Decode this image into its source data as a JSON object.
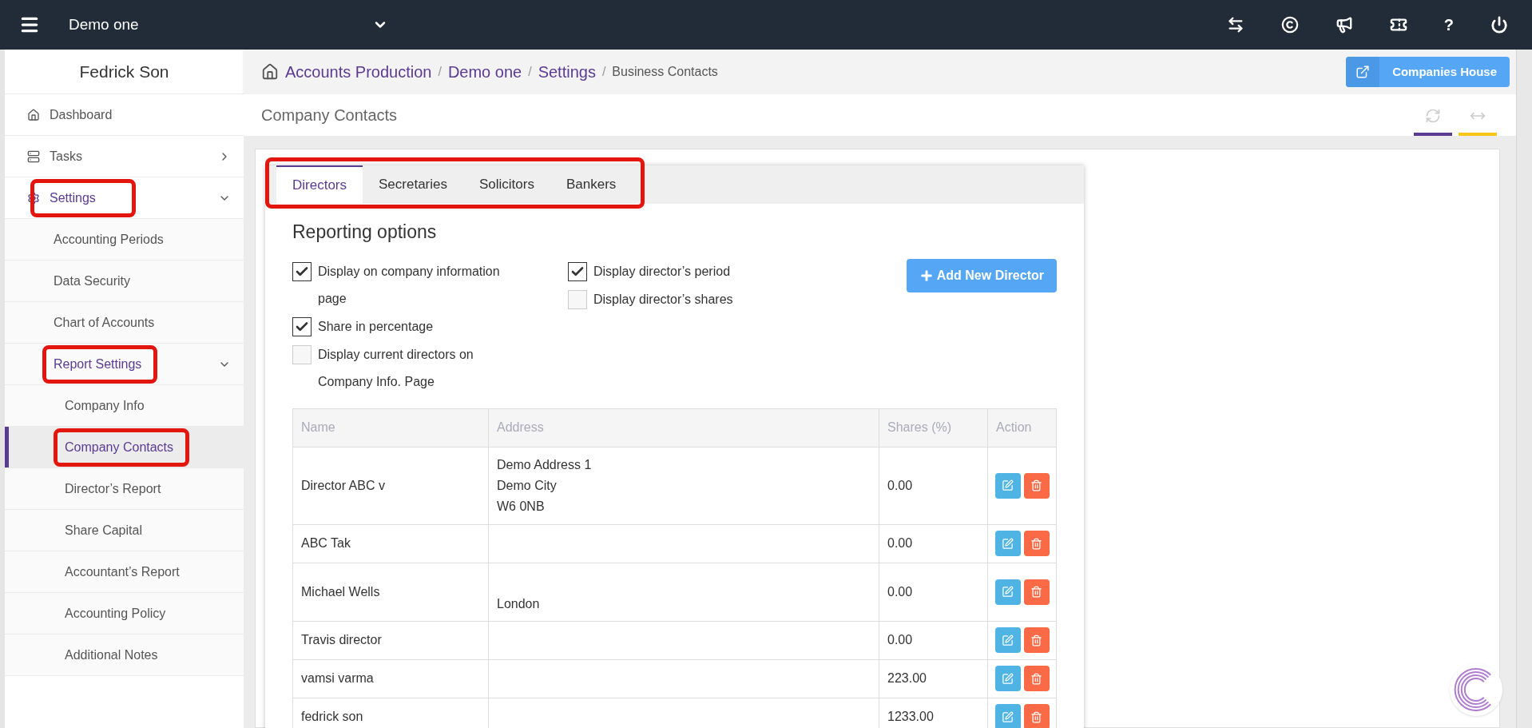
{
  "top_bar": {
    "company": "Demo one",
    "help": "?"
  },
  "sidebar": {
    "user": "Fedrick Son",
    "items": [
      {
        "label": "Dashboard",
        "selected": false,
        "highlighted": false
      },
      {
        "label": "Tasks",
        "expanded": false,
        "selected": false,
        "highlighted": false
      },
      {
        "label": "Settings",
        "expanded": true,
        "selected": false,
        "highlighted": true,
        "children": [
          {
            "label": "Accounting Periods",
            "selected": false,
            "highlighted": false
          },
          {
            "label": "Data Security",
            "selected": false,
            "highlighted": false
          },
          {
            "label": "Chart of Accounts",
            "selected": false,
            "highlighted": false
          },
          {
            "label": "Report Settings",
            "expanded": true,
            "selected": false,
            "highlighted": true,
            "children": [
              {
                "label": "Company Info",
                "selected": false,
                "highlighted": false
              },
              {
                "label": "Company Contacts",
                "selected": true,
                "highlighted": true
              },
              {
                "label": "Director’s Report",
                "selected": false,
                "highlighted": false
              },
              {
                "label": "Share Capital",
                "selected": false,
                "highlighted": false
              },
              {
                "label": "Accountant’s Report",
                "selected": false,
                "highlighted": false
              },
              {
                "label": "Accounting Policy",
                "selected": false,
                "highlighted": false
              },
              {
                "label": "Additional Notes",
                "selected": false,
                "highlighted": false
              }
            ]
          }
        ]
      }
    ]
  },
  "breadcrumb_separator": "/",
  "breadcrumb": [
    {
      "label": "Accounts Production",
      "kind": "link"
    },
    {
      "label": "Demo one",
      "kind": "link"
    },
    {
      "label": "Settings",
      "kind": "link"
    },
    {
      "label": "Business Contacts",
      "kind": "current"
    }
  ],
  "companies_house_button": "Companies House",
  "page_title": "Company Contacts",
  "tabs_highlighted": true,
  "tabs": [
    {
      "label": "Directors",
      "selected": true
    },
    {
      "label": "Secretaries",
      "selected": false
    },
    {
      "label": "Solicitors",
      "selected": false
    },
    {
      "label": "Bankers",
      "selected": false
    }
  ],
  "reporting_options": {
    "title": "Reporting options",
    "left": [
      {
        "label": "Display on company information page",
        "checked": true
      },
      {
        "label": "Share in percentage",
        "checked": true
      },
      {
        "label": "Display current directors on Company Info. Page",
        "checked": false
      }
    ],
    "right": [
      {
        "label": "Display director’s period",
        "checked": true
      },
      {
        "label": "Display director’s shares",
        "checked": false
      }
    ]
  },
  "add_button": "Add New Director",
  "table": {
    "columns": [
      "Name",
      "Address",
      "Shares (%)",
      "Action"
    ],
    "rows": [
      {
        "kind": "standard",
        "name": "Director ABC v",
        "address": [
          "Demo Address 1",
          "Demo City",
          "W6 0NB"
        ],
        "shares": "0.00"
      },
      {
        "kind": "standard",
        "name": "ABC Tak",
        "address": [],
        "shares": "0.00"
      },
      {
        "kind": "lowered",
        "name": "Michael Wells",
        "address": [
          "London"
        ],
        "shares": "0.00"
      },
      {
        "kind": "standard",
        "name": "Travis director",
        "address": [],
        "shares": "0.00"
      },
      {
        "kind": "standard",
        "name": "vamsi varma",
        "address": [],
        "shares": "223.00"
      },
      {
        "kind": "standard",
        "name": "fedrick son",
        "address": [],
        "shares": "1233.00"
      }
    ]
  }
}
